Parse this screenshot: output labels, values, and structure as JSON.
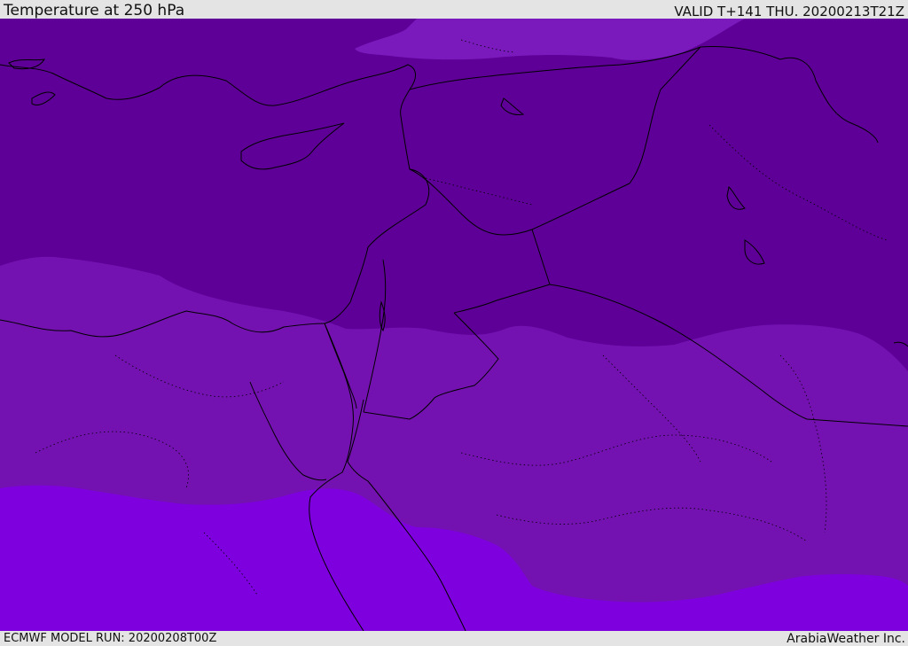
{
  "header": {
    "title": "Temperature at 250 hPa",
    "valid_time": "VALID T+141 THU. 20200213T21Z"
  },
  "footer": {
    "model_run": "ECMWF MODEL RUN: 20200208T00Z",
    "credit": "ArabiaWeather Inc."
  },
  "map": {
    "variable": "Temperature",
    "level_hpa": 250,
    "region": "Eastern Mediterranean / Middle East",
    "colors": {
      "band_coldest": "#5e0097",
      "band_middle": "#7412b1",
      "band_warmest": "#7e00de",
      "band_upper_light": "#7a1abd",
      "coastline": "#000000",
      "border": "#000000",
      "admin_border": "#000000"
    }
  }
}
